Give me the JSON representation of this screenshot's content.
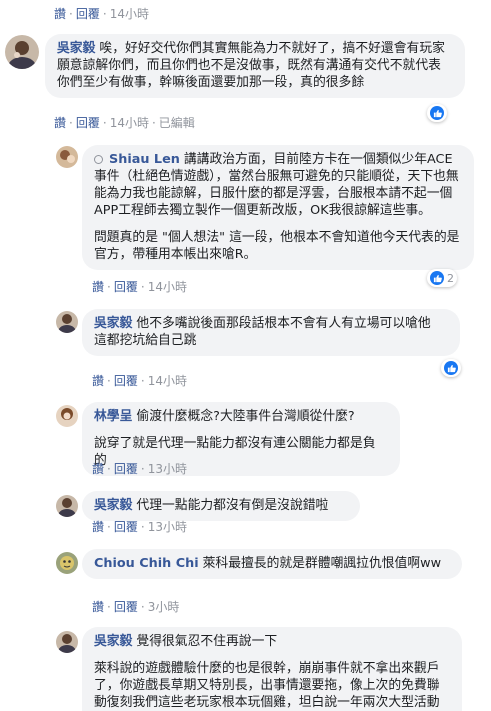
{
  "labels": {
    "like": "讚",
    "reply": "回覆",
    "dot": "·",
    "edited": "已編輯"
  },
  "comments": [
    {
      "time": "14小時"
    },
    {
      "author": "吳家毅",
      "text": "唉，好好交代你們其實無能為力不就好了，搞不好還會有玩家願意諒解你們，而且你們也不是沒做事，既然有溝通有交代不就代表你們至少有做事，幹嘛後面還要加那一段，真的很多餘",
      "time": "14小時",
      "edited": true,
      "reactions": ""
    },
    {
      "author": "Shiau Len",
      "tag": "",
      "paragraphs": [
        "講講政治方面，目前陸方卡在一個類似少年ACE事件（杜絕色情遊戲），當然台服無可避免的只能順從，天下也無能為力我也能諒解，日服什麼的都是浮雲，台服根本請不起一個APP工程師去獨立製作一個更新改版，OK我很諒解這些事。",
        "問題真的是 \"個人想法\" 這一段，他根本不會知道他今天代表的是官方，帶種用本帳出來嗆R。"
      ],
      "time": "14小時",
      "reactions": "2"
    },
    {
      "author": "吳家毅",
      "paragraphs": [
        "他不多嘴說後面那段話根本不會有人有立場可以嗆他",
        "這都挖坑給自己跳"
      ],
      "time": "14小時",
      "reactions": ""
    },
    {
      "author": "林學呈",
      "paragraphs": [
        "偷渡什麼概念?大陸事件台灣順從什麼?",
        "說穿了就是代理一點能力都沒有連公關能力都是負的"
      ],
      "time": "13小時"
    },
    {
      "author": "吳家毅",
      "paragraphs": [
        "代理一點能力都沒有倒是沒說錯啦"
      ],
      "time": "13小時"
    },
    {
      "author": "Chiou Chih Chi",
      "paragraphs": [
        "萊科最擅長的就是群體嘲諷拉仇恨值啊ww"
      ],
      "time": "3小時"
    },
    {
      "author": "吳家毅",
      "paragraphs": [
        "覺得很氣忍不住再說一下",
        "萊科說的遊戲體驗什麼的也是很幹，崩崩事件就不拿出來觀戶了，你遊戲長草期又特別長，出事情還要拖，像上次的免費聯動復刻我們這些老玩家根本玩個雞，坦白說一年兩次大型活動都沒有的"
      ]
    }
  ],
  "icons": {
    "like": "thumbs-up-icon",
    "edit": "edited-circle-icon"
  },
  "colors": {
    "link": "#385898",
    "bubble": "#f2f3f5",
    "like": "#1877f2",
    "meta": "#90949c"
  }
}
